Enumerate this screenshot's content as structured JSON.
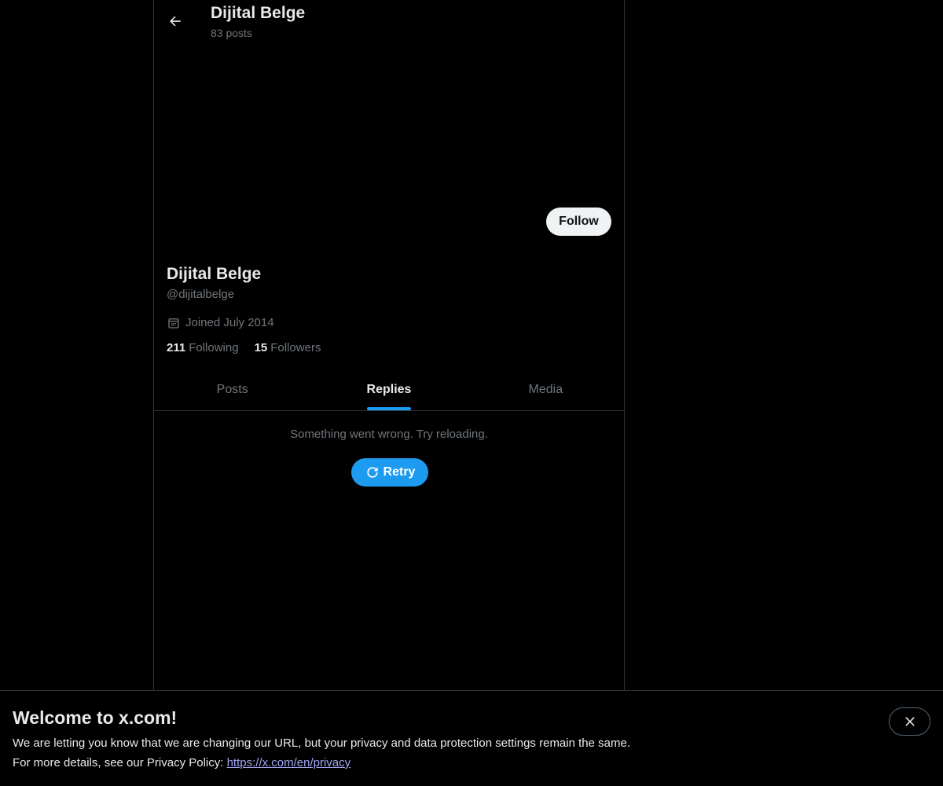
{
  "header": {
    "title": "Dijital Belge",
    "post_count": "83 posts",
    "back_icon": "arrow-left-icon"
  },
  "profile": {
    "follow_label": "Follow",
    "display_name": "Dijital Belge",
    "handle": "@dijitalbelge",
    "joined": "Joined July 2014",
    "joined_icon": "calendar-icon",
    "following_count": "211",
    "following_label": "Following",
    "followers_count": "15",
    "followers_label": "Followers"
  },
  "tabs": [
    {
      "label": "Posts",
      "active": false
    },
    {
      "label": "Replies",
      "active": true
    },
    {
      "label": "Media",
      "active": false
    }
  ],
  "error": {
    "message": "Something went wrong. Try reloading.",
    "retry_label": "Retry",
    "retry_icon": "refresh-icon"
  },
  "banner": {
    "title": "Welcome to x.com!",
    "line1": "We are letting you know that we are changing our URL, but your privacy and data protection settings remain the same.",
    "line2_prefix": "For more details, see our Privacy Policy: ",
    "link": "https://x.com/en/privacy",
    "close_icon": "close-icon"
  },
  "colors": {
    "background": "#000000",
    "accent": "#1d9bf0",
    "text_primary": "#e7e9ea",
    "text_secondary": "#71767b",
    "border": "#2f3336",
    "link": "#a2a5f5"
  }
}
